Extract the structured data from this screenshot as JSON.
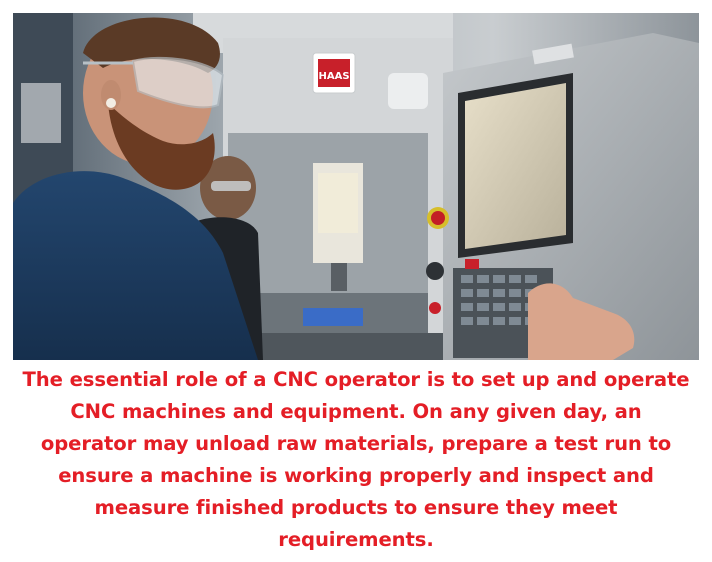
{
  "photo": {
    "brand_mark": "HAAS"
  },
  "caption": {
    "lines": [
      "The essential role of a CNC operator is to set up and operate",
      "CNC machines and equipment. On any given day, an",
      "operator may unload raw materials, prepare a test run to",
      "ensure a machine is working properly and inspect and",
      "measure finished products to ensure they meet",
      "requirements."
    ],
    "color": "#e41e26"
  }
}
